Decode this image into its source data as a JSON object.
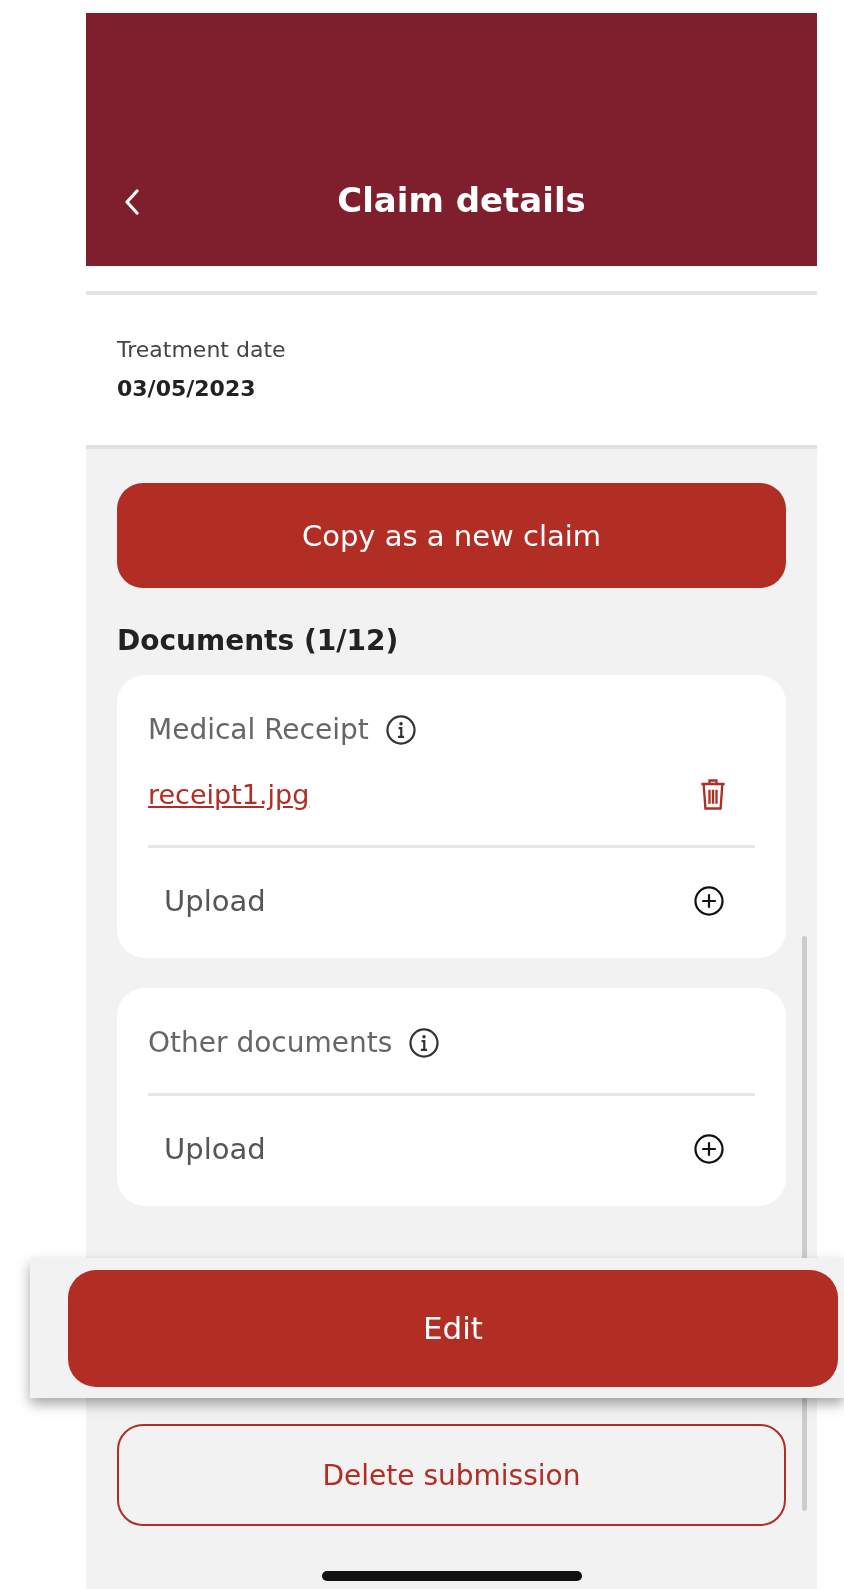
{
  "header": {
    "title": "Claim details"
  },
  "treatment": {
    "label": "Treatment date",
    "value": "03/05/2023"
  },
  "copy_button": "Copy as a new claim",
  "documents": {
    "heading": "Documents (1/12)",
    "groups": [
      {
        "title": "Medical Receipt",
        "files": [
          "receipt1.jpg"
        ],
        "upload": "Upload"
      },
      {
        "title": "Other documents",
        "upload": "Upload"
      }
    ]
  },
  "edit_button": "Edit",
  "delete_button": "Delete submission"
}
